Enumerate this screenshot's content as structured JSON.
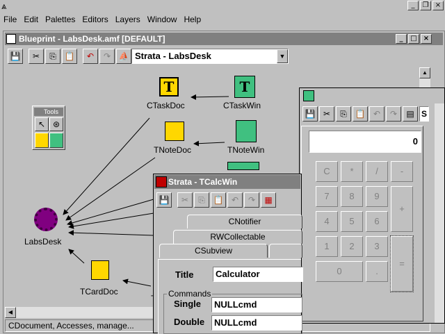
{
  "menubar": {
    "items": [
      "File",
      "Edit",
      "Palettes",
      "Editors",
      "Layers",
      "Window",
      "Help"
    ],
    "mnemonics": [
      "F",
      "E",
      "P",
      "E",
      "L",
      "W",
      "H"
    ]
  },
  "blueprint": {
    "title": "Blueprint - LabsDesk.amf [DEFAULT]",
    "combo_value": "Strata - LabsDesk",
    "status_text": "CDocument, Accesses, manage..."
  },
  "diagram": {
    "nodes": [
      {
        "label": "CTaskDoc"
      },
      {
        "label": "CTaskWin"
      },
      {
        "label": "TNoteDoc"
      },
      {
        "label": "TNoteWin"
      },
      {
        "label": "LabsDesk"
      },
      {
        "label": "TCardDoc"
      },
      {
        "label": "T"
      }
    ]
  },
  "tools_palette": {
    "title": "Tools"
  },
  "calculator": {
    "display": "0",
    "keys": [
      "C",
      "*",
      "/",
      "-",
      "7",
      "8",
      "9",
      "+",
      "4",
      "5",
      "6",
      "1",
      "2",
      "3",
      "=",
      "0",
      "."
    ],
    "combo_fragment": "S"
  },
  "strata": {
    "title": "Strata - TCalcWin",
    "tabs": [
      "CNotifier",
      "RWCollectable",
      "CSubview"
    ],
    "title_label": "Title",
    "title_value": "Calculator",
    "commands_label": "Commands",
    "single_label": "Single",
    "single_value": "NULLcmd",
    "double_label": "Double",
    "double_value": "NULLcmd"
  },
  "colors": {
    "face": "#c0c0c0",
    "inactive_title": "#808080",
    "icon_yellow": "#ffd700",
    "icon_green": "#40c080",
    "accent_purple": "#800080"
  }
}
